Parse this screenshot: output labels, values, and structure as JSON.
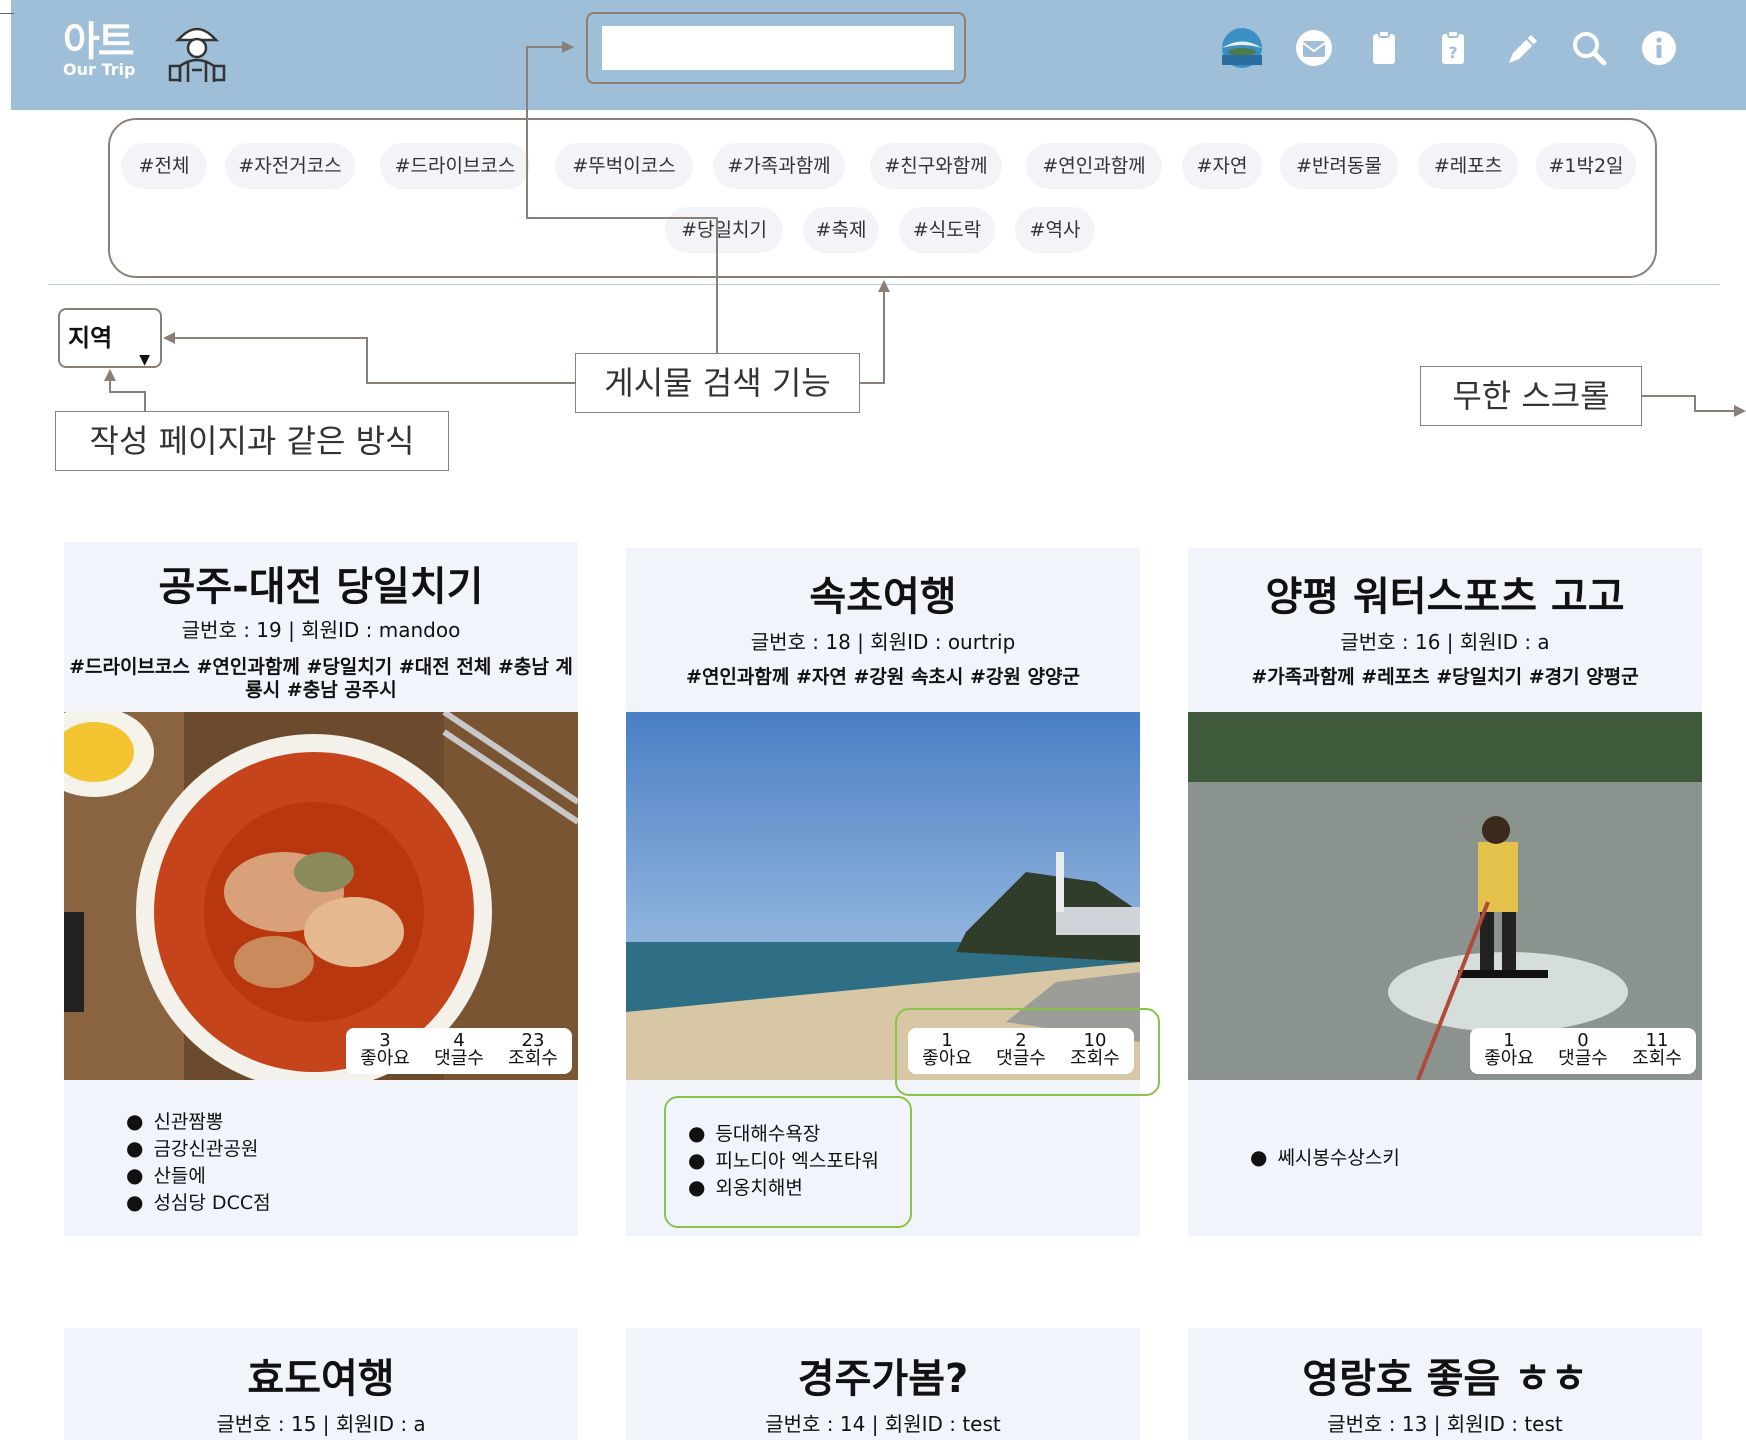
{
  "header": {
    "logo_kr": "아트",
    "logo_en": "Our Trip",
    "search_value": "",
    "icons": [
      "globe-icon",
      "mail-icon",
      "clipboard-icon",
      "clipboard-question-icon",
      "pen-icon",
      "search-icon",
      "info-icon"
    ]
  },
  "tags": [
    "#전체",
    "#자전거코스",
    "#드라이브코스",
    "#뚜벅이코스",
    "#가족과함께",
    "#친구와함께",
    "#연인과함께",
    "#자연",
    "#반려동물",
    "#레포츠",
    "#1박2일",
    "#당일치기",
    "#축제",
    "#식도락",
    "#역사"
  ],
  "region_select": "지역",
  "annotations": {
    "search_feature": "게시물 검색 기능",
    "same_as_write": "작성 페이지과 같은 방식",
    "infinite_scroll": "무한 스크롤"
  },
  "stats_labels": [
    "좋아요",
    "댓글수",
    "조회수"
  ],
  "posts": [
    {
      "title": "공주-대전 당일치기",
      "meta": "글번호 : 19  |  회원ID : mandoo",
      "tags": "#드라이브코스 #연인과함께 #당일치기 #대전 전체 #충남 계룡시 #충남 공주시",
      "likes": "3",
      "comments": "4",
      "views": "23",
      "places": [
        "신관짬뽕",
        "금강신관공원",
        "산들에",
        "성심당 DCC점"
      ]
    },
    {
      "title": "속초여행",
      "meta": "글번호 : 18  |  회원ID : ourtrip",
      "tags": "#연인과함께 #자연 #강원 속초시 #강원 양양군",
      "likes": "1",
      "comments": "2",
      "views": "10",
      "places": [
        "등대해수욕장",
        "피노디아 엑스포타워",
        "외옹치해변"
      ]
    },
    {
      "title": "양평 워터스포츠 고고",
      "meta": "글번호 : 16  |  회원ID : a",
      "tags": "#가족과함께 #레포츠 #당일치기 #경기 양평군",
      "likes": "1",
      "comments": "0",
      "views": "11",
      "places": [
        "쎄시봉수상스키"
      ]
    },
    {
      "title": "효도여행",
      "meta": "글번호 : 15  |  회원ID : a"
    },
    {
      "title": "경주가봄?",
      "meta": "글번호 : 14  |  회원ID : test"
    },
    {
      "title": "영랑호 좋음 ㅎㅎ",
      "meta": "글번호 : 13  |  회원ID : test"
    }
  ]
}
